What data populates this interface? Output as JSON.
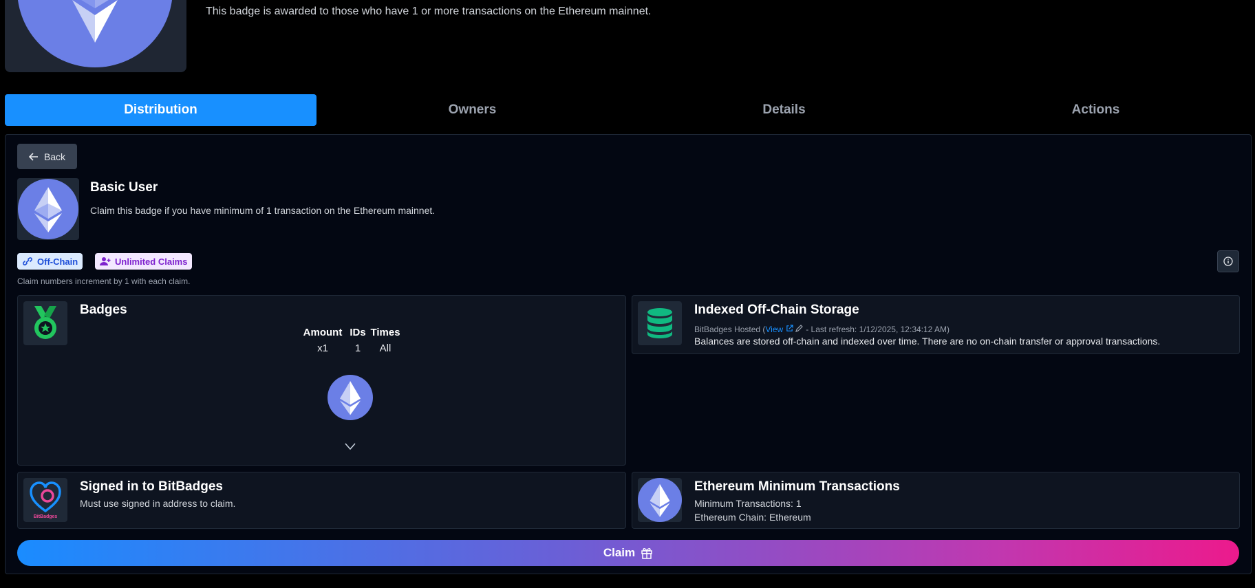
{
  "hero": {
    "description": "This badge is awarded to those who have 1 or more transactions on the Ethereum mainnet."
  },
  "tabs": [
    {
      "label": "Distribution",
      "active": true
    },
    {
      "label": "Owners",
      "active": false
    },
    {
      "label": "Details",
      "active": false
    },
    {
      "label": "Actions",
      "active": false
    }
  ],
  "back": {
    "label": "Back"
  },
  "claim": {
    "title": "Basic User",
    "description": "Claim this badge if you have minimum of 1 transaction on the Ethereum mainnet.",
    "tags": {
      "offchain": "Off-Chain",
      "unlimited": "Unlimited Claims"
    },
    "note": "Claim numbers increment by 1 with each claim.",
    "button_label": "Claim"
  },
  "badges_card": {
    "title": "Badges",
    "headers": [
      "Amount",
      "IDs",
      "Times"
    ],
    "row": [
      "x1",
      "1",
      "All"
    ]
  },
  "storage_card": {
    "title": "Indexed Off-Chain Storage",
    "hosted_prefix": "BitBadges Hosted (",
    "view_link": "View",
    "refresh_text": "- Last refresh: 1/12/2025, 12:34:12 AM)",
    "description": "Balances are stored off-chain and indexed over time. There are no on-chain transfer or approval transactions."
  },
  "signin_card": {
    "title": "Signed in to BitBadges",
    "description": "Must use signed in address to claim.",
    "logo_text": "BitBadges"
  },
  "eth_card": {
    "title": "Ethereum Minimum Transactions",
    "line1": "Minimum Transactions: 1",
    "line2": "Ethereum Chain: Ethereum"
  },
  "colors": {
    "accent": "#1890ff",
    "eth_disc": "#6b7fe6",
    "medal_green": "#22c55e",
    "db_green": "#10b981"
  }
}
